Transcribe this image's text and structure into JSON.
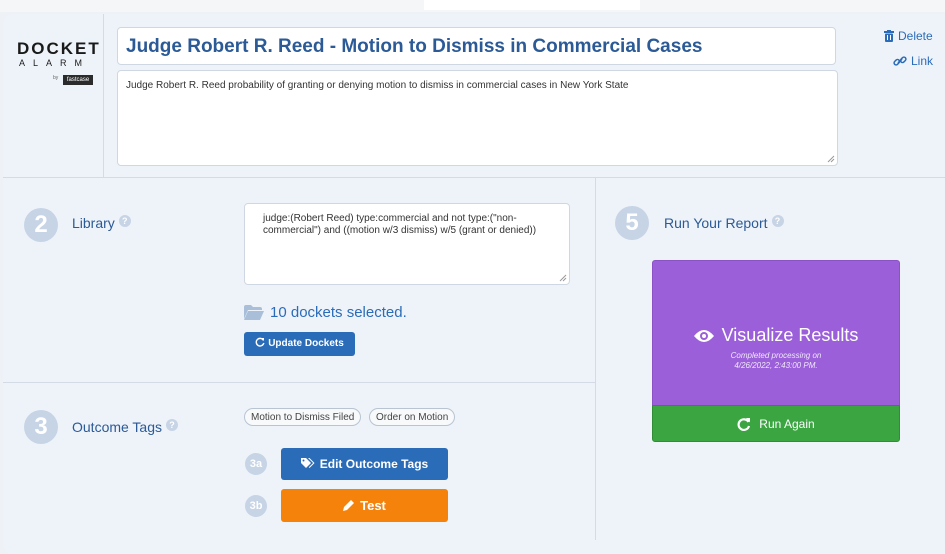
{
  "brand": {
    "name": "DOCKET",
    "sub": "ALARM",
    "by": "by",
    "badge": "fastcase"
  },
  "report": {
    "title": "Judge Robert R. Reed - Motion to Dismiss in Commercial Cases",
    "description": "Judge Robert R. Reed probability of granting or denying motion to  dismiss in commercial cases in New York State"
  },
  "header_actions": {
    "delete_label": "Delete",
    "link_label": "Link"
  },
  "library": {
    "step": "2",
    "label": "Library",
    "query": "judge:(Robert Reed) type:commercial and not type:(\"non-commercial\") and ((motion w/3 dismiss) w/5 (grant or denied))",
    "dockets_text": "10 dockets selected.",
    "update_button": "Update Dockets"
  },
  "outcome_tags": {
    "step": "3",
    "label": "Outcome Tags",
    "tags": [
      "Motion to Dismiss Filed",
      "Order on Motion"
    ],
    "step_a": "3a",
    "edit_button": "Edit Outcome Tags",
    "step_b": "3b",
    "test_button": "Test"
  },
  "run_report": {
    "step": "5",
    "label": "Run Your Report",
    "visualize_label": "Visualize Results",
    "status_line1": "Completed processing on",
    "status_line2": "4/26/2022, 2:43:00 PM.",
    "run_again_label": "Run Again"
  },
  "help_glyph": "?",
  "colors": {
    "accent_blue": "#2b6cb8",
    "title_blue": "#2b5a96",
    "visualize_purple": "#9b60d9",
    "run_green": "#3ba541",
    "test_orange": "#f5820a",
    "step_circle": "#c6d4e6"
  }
}
